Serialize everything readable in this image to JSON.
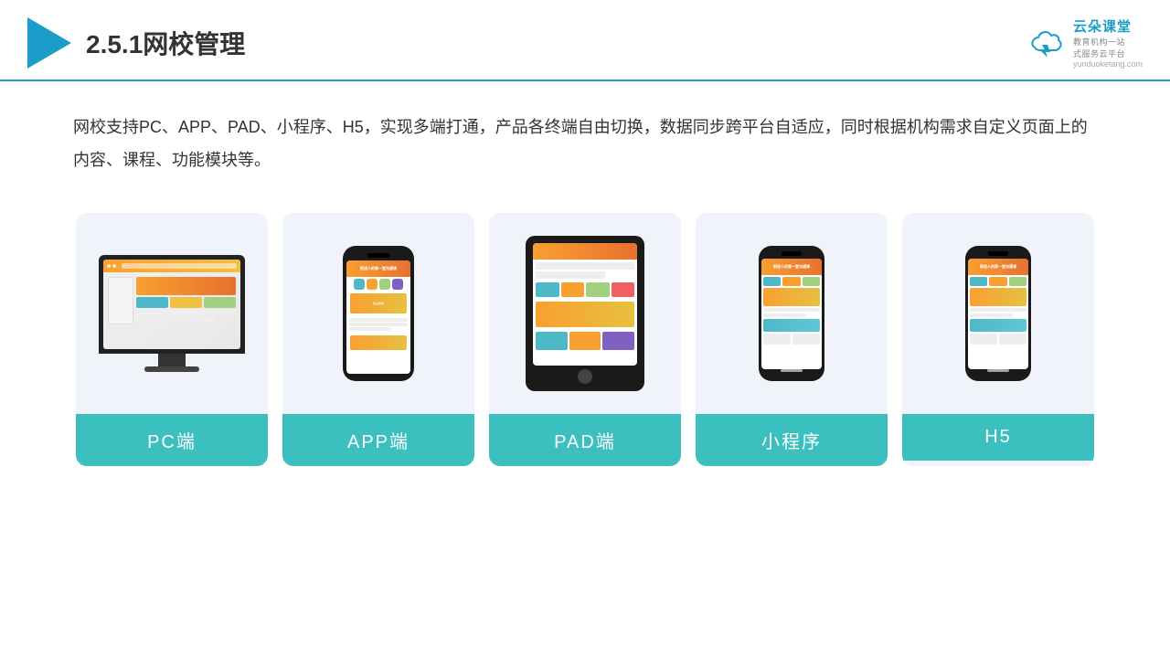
{
  "header": {
    "title": "2.5.1网校管理",
    "logo_main": "云朵课堂",
    "logo_sub": "教育机构一站\n式服务云平台",
    "logo_url": "yunduoketang.com"
  },
  "description": {
    "text": "网校支持PC、APP、PAD、小程序、H5，实现多端打通，产品各终端自由切换，数据同步跨平台自适应，同时根据机构需求自定义页面上的内容、课程、功能模块等。"
  },
  "cards": [
    {
      "label": "PC端"
    },
    {
      "label": "APP端"
    },
    {
      "label": "PAD端"
    },
    {
      "label": "小程序"
    },
    {
      "label": "H5"
    }
  ],
  "colors": {
    "accent": "#1a9ec9",
    "teal": "#3bbfbf",
    "bg_card": "#f0f4fa"
  }
}
